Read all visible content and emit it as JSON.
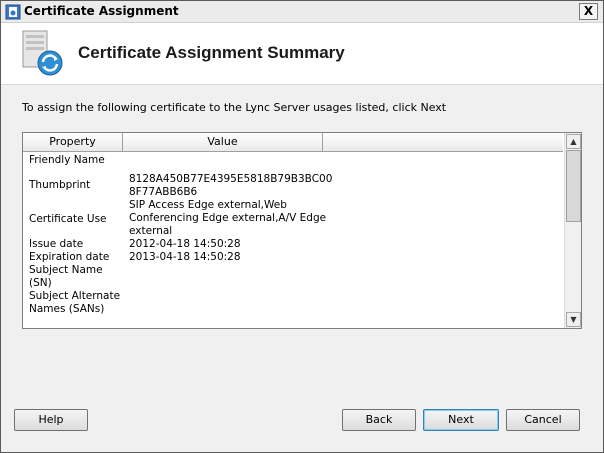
{
  "window": {
    "title": "Certificate Assignment",
    "close_glyph": "X"
  },
  "header": {
    "title": "Certificate Assignment Summary",
    "icon": "certificate-server-icon"
  },
  "instruction": "To assign the following certificate to the Lync Server usages listed, click Next",
  "grid": {
    "columns": [
      "Property",
      "Value"
    ],
    "rows": [
      {
        "property": "Friendly Name",
        "value": ""
      },
      {
        "property": "Thumbprint",
        "value": "8128A450B77E4395E5818B79B3BC00\n8F77ABB6B6"
      },
      {
        "property": "Certificate Use",
        "value": "SIP Access Edge external,Web\nConferencing Edge external,A/V Edge\nexternal"
      },
      {
        "property": "Issue date",
        "value": "2012-04-18 14:50:28"
      },
      {
        "property": "Expiration date",
        "value": "2013-04-18 14:50:28"
      },
      {
        "property": "Subject Name\n(SN)",
        "value": ""
      },
      {
        "property": "Subject Alternate\nNames (SANs)",
        "value": ""
      }
    ]
  },
  "buttons": {
    "help": "Help",
    "back": "Back",
    "next": "Next",
    "cancel": "Cancel"
  }
}
